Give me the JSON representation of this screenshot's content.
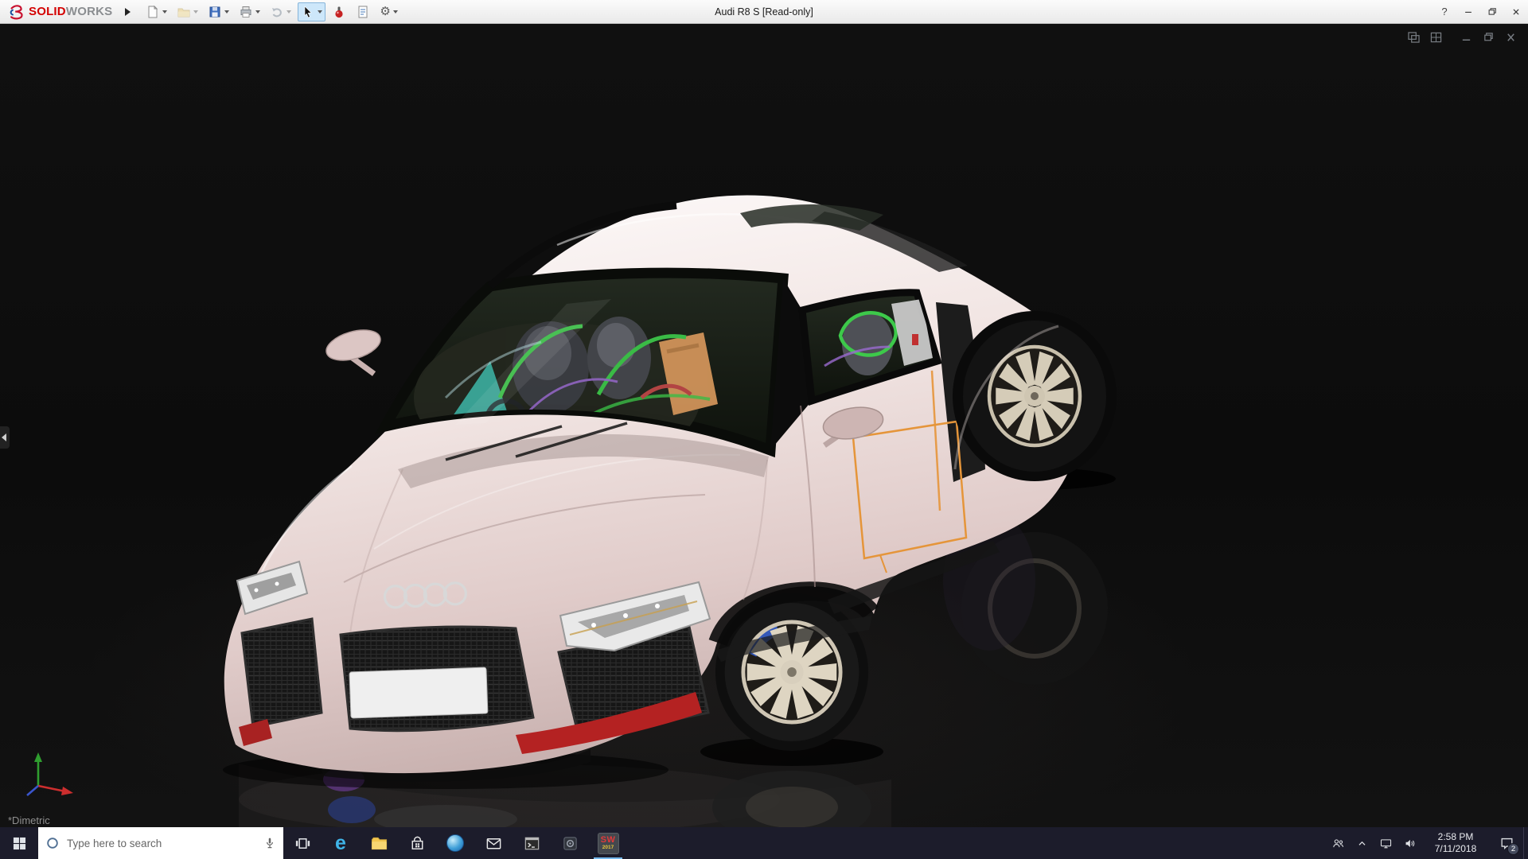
{
  "titlebar": {
    "logo_solid": "SOLID",
    "logo_works": "WORKS",
    "document_title": "Audi R8 S [Read-only]",
    "help_label": "?"
  },
  "viewport": {
    "view_orientation_label": "*Dimetric"
  },
  "taskbar": {
    "search_placeholder": "Type here to search",
    "edge_glyph": "e",
    "solidworks_label": "SW",
    "solidworks_year": "2017",
    "clock_time": "2:58 PM",
    "clock_date": "7/11/2018",
    "notification_badge": "2"
  },
  "colors": {
    "solidworks_red": "#d40000",
    "taskbar_background": "#1c1c2b",
    "car_body_pearl": "#eee0de",
    "interior_cage_green": "#3dc94a",
    "sketch_orange": "#e5953a"
  }
}
